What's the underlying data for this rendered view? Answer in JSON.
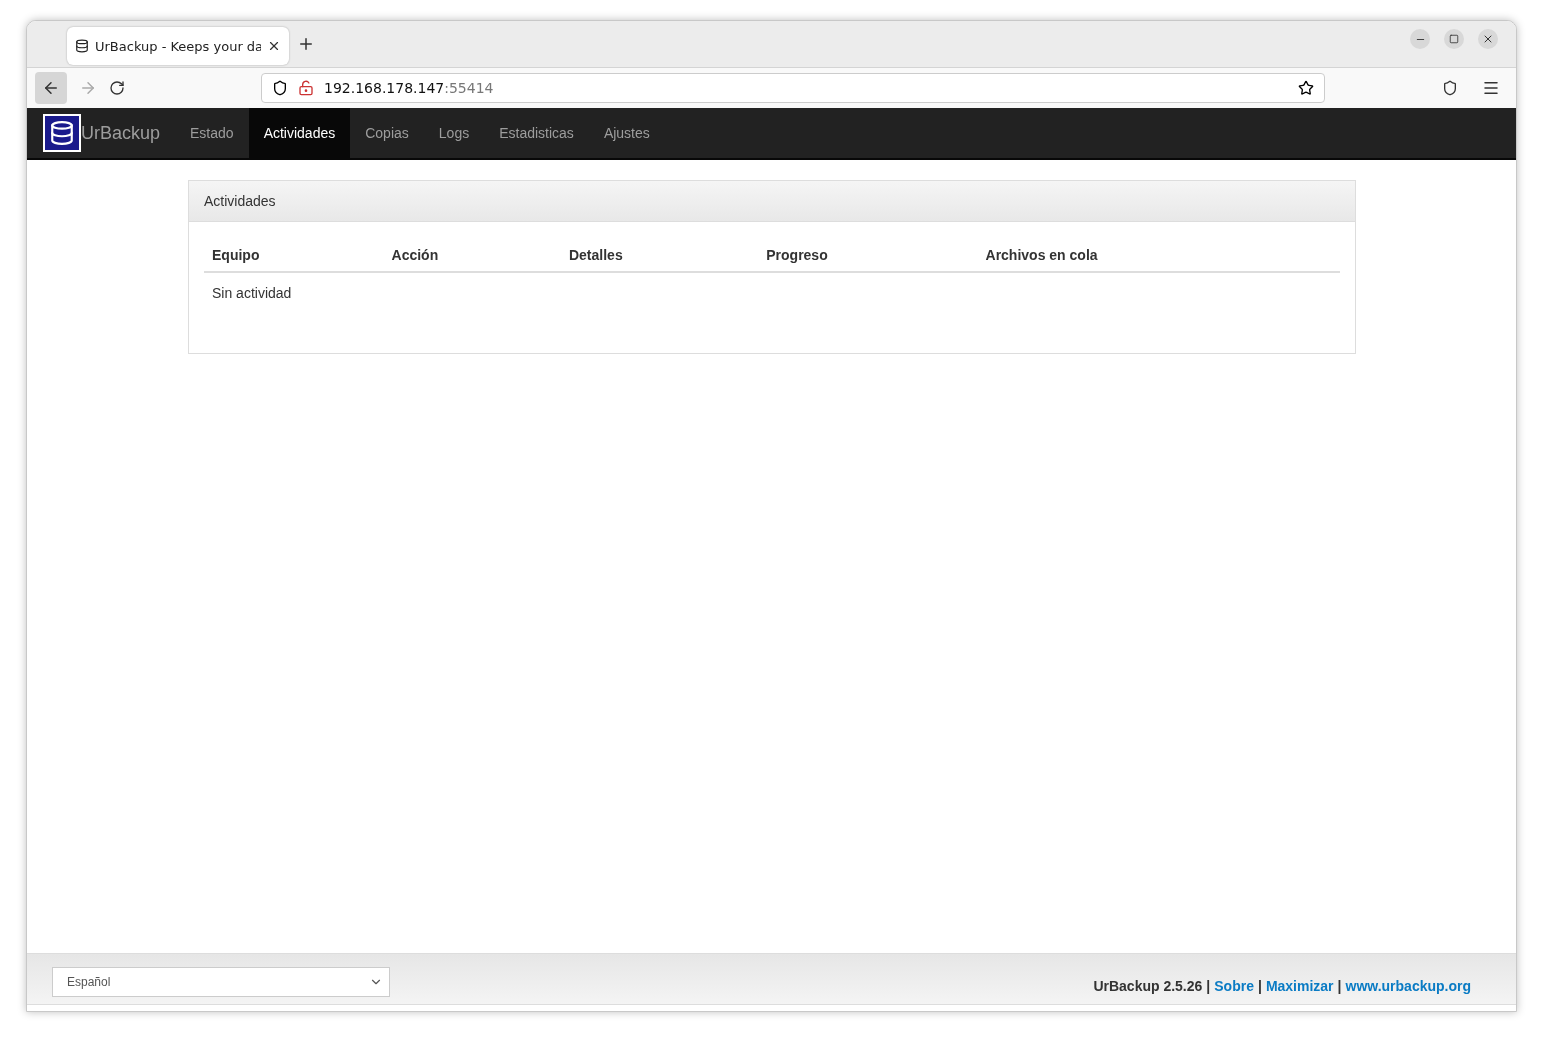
{
  "browser": {
    "tab_title": "UrBackup - Keeps your da",
    "url_host": "192.168.178.147",
    "url_port": ":55414"
  },
  "navbar": {
    "brand": "UrBackup",
    "items": [
      {
        "label": "Estado",
        "selected": false
      },
      {
        "label": "Actividades",
        "selected": true
      },
      {
        "label": "Copias",
        "selected": false
      },
      {
        "label": "Logs",
        "selected": false
      },
      {
        "label": "Estadisticas",
        "selected": false
      },
      {
        "label": "Ajustes",
        "selected": false
      }
    ]
  },
  "panel": {
    "title": "Actividades",
    "columns": [
      "Equipo",
      "Acción",
      "Detalles",
      "Progreso",
      "Archivos en cola"
    ],
    "empty_message": "Sin actividad"
  },
  "footer": {
    "language": "Español",
    "version": "UrBackup 2.5.26",
    "separator": "|",
    "links": [
      "Sobre",
      "Maximizar",
      "www.urbackup.org"
    ]
  }
}
